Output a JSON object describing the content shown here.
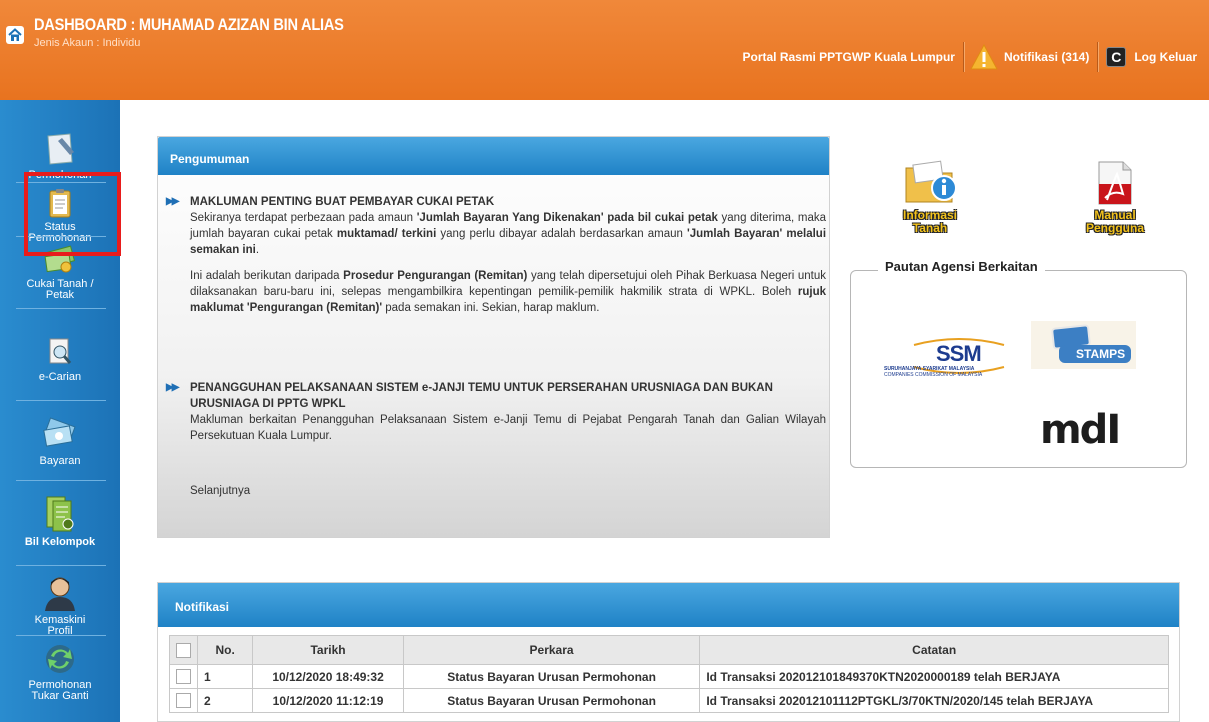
{
  "header": {
    "title": "DASHBOARD : MUHAMAD AZIZAN BIN ALIAS",
    "account_type": "Jenis Akaun : Individu",
    "portal_link": "Portal Rasmi PPTGWP Kuala Lumpur",
    "notifications": "Notifikasi (314)",
    "logout": "Log Keluar",
    "logout_glyph": "C"
  },
  "sidebar": {
    "items": [
      {
        "label": "Permohonan",
        "icon": "document-pen-icon"
      },
      {
        "label": "Status Permohonan",
        "icon": "clipboard-icon"
      },
      {
        "label": "Cukai Tanah / Petak",
        "icon": "money-icon"
      },
      {
        "label": "e-Carian",
        "icon": "magnify-document-icon"
      },
      {
        "label": "Bayaran",
        "icon": "money-stack-icon"
      },
      {
        "label": "Bil Kelompok",
        "icon": "bill-group-icon"
      },
      {
        "label": "Kemaskini Profil",
        "icon": "user-icon"
      },
      {
        "label": "Permohonan Tukar Ganti",
        "icon": "exchange-icon"
      }
    ]
  },
  "announcement": {
    "heading": "Pengumuman",
    "item1": {
      "title": "MAKLUMAN PENTING BUAT PEMBAYAR CUKAI PETAK",
      "p1_a": "Sekiranya terdapat perbezaan pada amaun ",
      "p1_b": "'Jumlah Bayaran Yang Dikenakan' pada bil cukai petak",
      "p1_c": " yang diterima, maka jumlah bayaran cukai petak ",
      "p1_d": "muktamad/ terkini",
      "p1_e": " yang perlu dibayar adalah berdasarkan amaun ",
      "p1_f": "'Jumlah Bayaran' melalui semakan ini",
      "p1_g": ".",
      "p2_a": "Ini adalah berikutan daripada ",
      "p2_b": "Prosedur Pengurangan (Remitan)",
      "p2_c": " yang telah dipersetujui oleh Pihak Berkuasa Negeri untuk dilaksanakan baru-baru ini, selepas mengambilkira kepentingan pemilik-pemilik hakmilik strata di WPKL. Boleh ",
      "p2_d": "rujuk maklumat 'Pengurangan (Remitan)'",
      "p2_e": " pada semakan ini. Sekian, harap maklum."
    },
    "item2": {
      "title": "PENANGGUHAN PELAKSANAAN SISTEM e-JANJI TEMU UNTUK PERSERAHAN URUSNIAGA DAN BUKAN URUSNIAGA DI PPTG WPKL",
      "body": "Makluman berkaitan Penangguhan Pelaksanaan Sistem e-Janji Temu di Pejabat Pengarah Tanah dan Galian Wilayah Persekutuan Kuala Lumpur."
    },
    "more": "Selanjutnya"
  },
  "right": {
    "info_tanah": [
      "Informasi",
      "Tanah"
    ],
    "manual": [
      "Manual",
      "Pengguna"
    ],
    "agensi_title": "Pautan Agensi Berkaitan",
    "ssm_text": "SSM",
    "ssm_caption_1": "SURUHANJAYA SYARIKAT MALAYSIA",
    "ssm_caption_2": "COMPANIES COMMISSION OF MALAYSIA",
    "stamps_text": "STAMPS",
    "mdi_text": "mdI"
  },
  "notifikasi": {
    "heading": "Notifikasi",
    "columns": [
      "No.",
      "Tarikh",
      "Perkara",
      "Catatan"
    ],
    "rows": [
      {
        "no": "1",
        "tarikh": "10/12/2020 18:49:32",
        "perkara": "Status Bayaran Urusan Permohonan",
        "catatan": "Id Transaksi 202012101849370KTN2020000189 telah BERJAYA"
      },
      {
        "no": "2",
        "tarikh": "10/12/2020 11:12:19",
        "perkara": "Status Bayaran Urusan Permohonan",
        "catatan": "Id Transaksi 202012101112PTGKL/3/70KTN/2020/145 telah BERJAYA"
      }
    ]
  },
  "colors": {
    "header": "#e8731f",
    "sidebar": "#1c72b6",
    "panel_head": "#1f82c6",
    "highlight": "#e81c1c"
  }
}
